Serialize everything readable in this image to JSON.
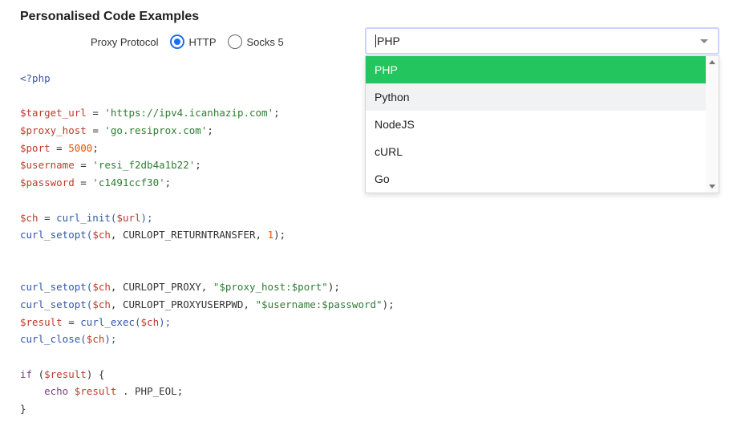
{
  "title": "Personalised Code Examples",
  "protocol": {
    "label": "Proxy Protocol",
    "options": [
      {
        "label": "HTTP",
        "checked": true
      },
      {
        "label": "Socks 5",
        "checked": false
      }
    ]
  },
  "language_select": {
    "value": "PHP",
    "options": [
      "PHP",
      "Python",
      "NodeJS",
      "cURL",
      "Go"
    ],
    "selected_index": 0,
    "hover_index": 1
  },
  "colors": {
    "selected_option": "#22c55e",
    "radio_accent": "#1b6ef3",
    "variable": "#c0392b",
    "string": "#2e7d32",
    "number": "#e65100",
    "function": "#3457a6",
    "keyword": "#7b3f8c"
  },
  "code": {
    "l1": {
      "a": "<?php"
    },
    "l3": {
      "a": "$target_url",
      "b": " = ",
      "c": "'https://ipv4.icanhazip.com'",
      "d": ";"
    },
    "l4": {
      "a": "$proxy_host",
      "b": " = ",
      "c": "'go.resiprox.com'",
      "d": ";"
    },
    "l5": {
      "a": "$port",
      "b": " = ",
      "c": "5000",
      "d": ";"
    },
    "l6": {
      "a": "$username",
      "b": " = ",
      "c": "'resi_f2db4a1b22'",
      "d": ";"
    },
    "l7": {
      "a": "$password",
      "b": " = ",
      "c": "'c1491ccf30'",
      "d": ";"
    },
    "l9": {
      "a": "$ch",
      "b": " = ",
      "c": "curl_init(",
      "d": "$url",
      "e": ");"
    },
    "l10": {
      "a": "curl_setopt(",
      "b": "$ch",
      "c": ", CURLOPT_RETURNTRANSFER, ",
      "d": "1",
      "e": ");"
    },
    "l13": {
      "a": "curl_setopt(",
      "b": "$ch",
      "c": ", CURLOPT_PROXY, ",
      "d": "\"$proxy_host:$port\"",
      "e": ");"
    },
    "l14": {
      "a": "curl_setopt(",
      "b": "$ch",
      "c": ", CURLOPT_PROXYUSERPWD, ",
      "d": "\"$username:$password\"",
      "e": ");"
    },
    "l15": {
      "a": "$result",
      "b": " = ",
      "c": "curl_exec(",
      "d": "$ch",
      "e": ");"
    },
    "l16": {
      "a": "curl_close(",
      "b": "$ch",
      "c": ");"
    },
    "l18": {
      "a": "if",
      "b": " (",
      "c": "$result",
      "d": ") {"
    },
    "l19": {
      "a": "    echo",
      "b": " ",
      "c": "$result",
      "d": " . PHP_EOL;"
    },
    "l20": {
      "a": "}"
    }
  }
}
